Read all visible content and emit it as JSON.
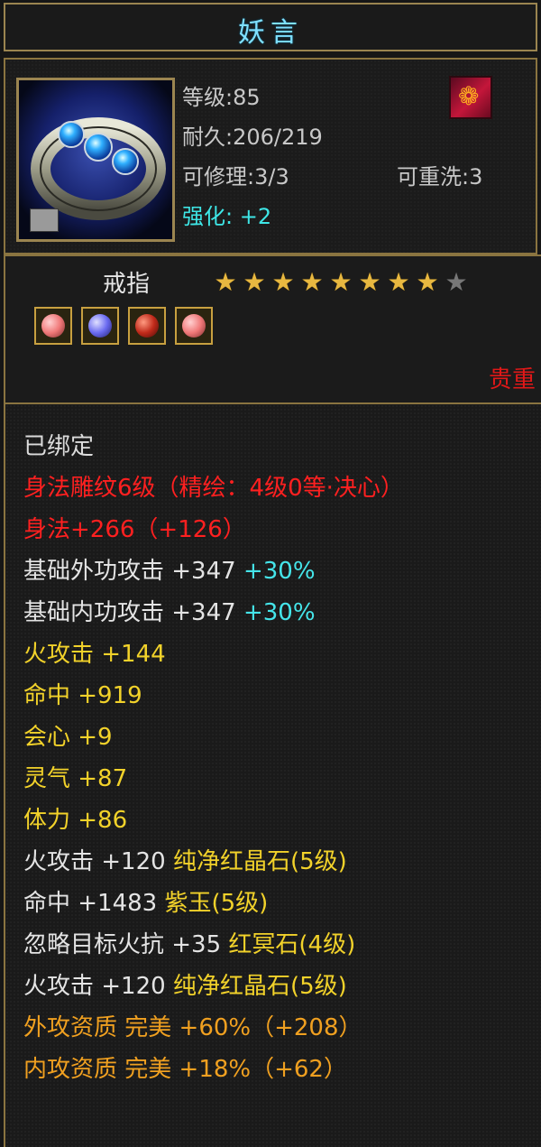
{
  "item": {
    "name": "妖言",
    "level": "等级:85",
    "durability": "耐久:206/219",
    "repair": "可修理:3/3",
    "rewash": "可重洗:3",
    "enhance": "强化: +2",
    "type": "戒指",
    "stars_total": 9,
    "stars_filled": 8,
    "rarity": "贵重",
    "gems": [
      {
        "name": "pink-gem",
        "color": "#f07878"
      },
      {
        "name": "blue-gem",
        "color": "#6a6af0"
      },
      {
        "name": "red-gem",
        "color": "#c02a1a"
      },
      {
        "name": "pink-gem",
        "color": "#f07878"
      }
    ]
  },
  "attributes": {
    "bound": "已绑定",
    "carving": "身法雕纹6级（精绘：4级0等·决心）",
    "agility": "身法+266（+126）",
    "base_ext_atk": "基础外功攻击 +347",
    "base_ext_atk_pct": "+30%",
    "base_int_atk": "基础内功攻击 +347",
    "base_int_atk_pct": "+30%",
    "fire_atk": "火攻击 +144",
    "hit": "命中 +919",
    "crit": "会心 +9",
    "spirit": "灵气 +87",
    "stamina": "体力 +86",
    "gem1_stat": "火攻击 +120",
    "gem1_name": "纯净红晶石(5级)",
    "gem2_stat": "命中 +1483",
    "gem2_name": "紫玉(5级)",
    "gem3_stat": "忽略目标火抗 +35",
    "gem3_name": "红冥石(4级)",
    "gem4_stat": "火攻击 +120",
    "gem4_name": "纯净红晶石(5级)",
    "ext_quality": "外攻资质  完美 +60%（+208）",
    "int_quality": "内攻资质  完美 +18%（+62）"
  }
}
